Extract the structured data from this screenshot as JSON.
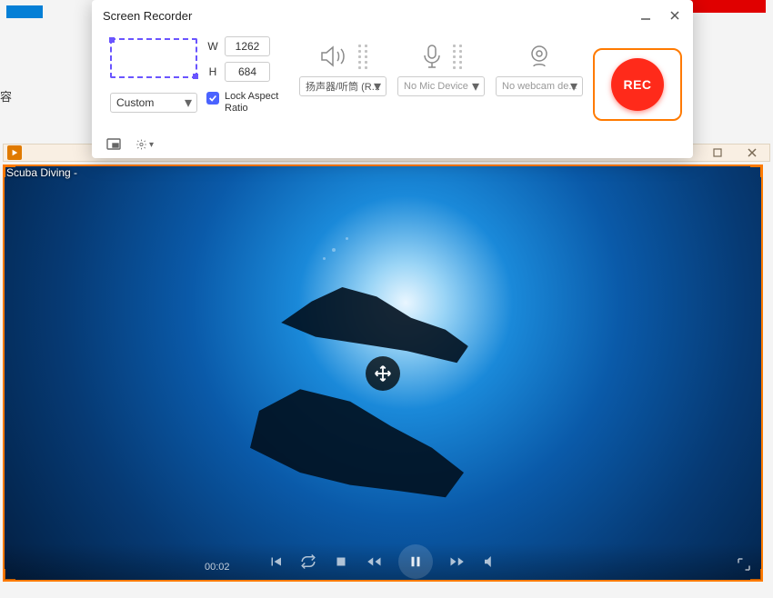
{
  "background": {
    "sidebar_fragment": "容",
    "player_titlebar": {}
  },
  "panel": {
    "title": "Screen Recorder",
    "region": {
      "w_label": "W",
      "h_label": "H",
      "width_value": "1262",
      "height_value": "684",
      "preset_selected": "Custom",
      "lock_label": "Lock Aspect Ratio",
      "lock_checked": true
    },
    "audio_out": {
      "selected": "扬声器/听筒 (R..."
    },
    "mic": {
      "placeholder": "No Mic Device"
    },
    "webcam": {
      "placeholder": "No webcam de..."
    },
    "rec_label": "REC"
  },
  "capture": {
    "overlay_title": "Scuba Diving -",
    "time": "00:02"
  }
}
